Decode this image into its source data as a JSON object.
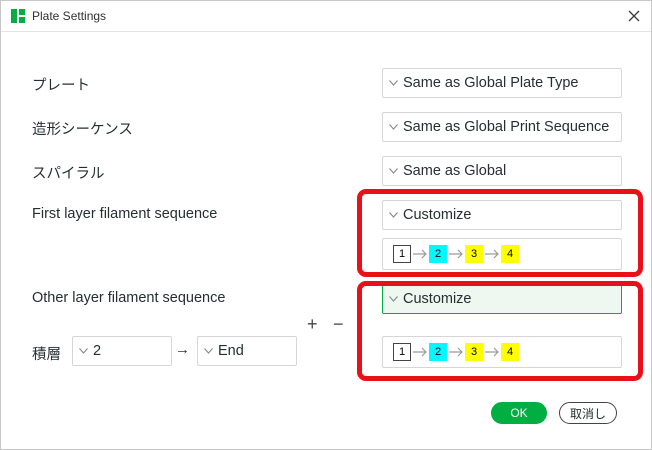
{
  "window": {
    "title": "Plate Settings"
  },
  "rows": {
    "plate": {
      "label": "プレート",
      "value": "Same as Global Plate Type"
    },
    "print_sequence": {
      "label": "造形シーケンス",
      "value": "Same as Global Print Sequence"
    },
    "spiral": {
      "label": "スパイラル",
      "value": "Same as Global"
    },
    "first_layer": {
      "label": "First layer filament sequence",
      "value": "Customize",
      "sequence": [
        "1",
        "2",
        "3",
        "4"
      ]
    },
    "other_layer": {
      "label": "Other layer filament sequence",
      "value": "Customize",
      "sequence": [
        "1",
        "2",
        "3",
        "4"
      ]
    }
  },
  "layer_range": {
    "label": "積層",
    "from": "2",
    "arrow": "→",
    "to": "End"
  },
  "controls": {
    "plus": "+",
    "minus": "−"
  },
  "buttons": {
    "ok": "OK",
    "cancel": "取消し"
  },
  "colors": {
    "accent": "#00ae42",
    "highlight": "#e8101a",
    "filament_2": "#00f8ff",
    "filament_3": "#ffff00",
    "filament_4": "#ffff00"
  },
  "icons": {
    "app": "bambu-studio-icon",
    "close": "close-icon",
    "chevron": "chevron-down-icon",
    "arrow": "arrow-right-icon"
  }
}
